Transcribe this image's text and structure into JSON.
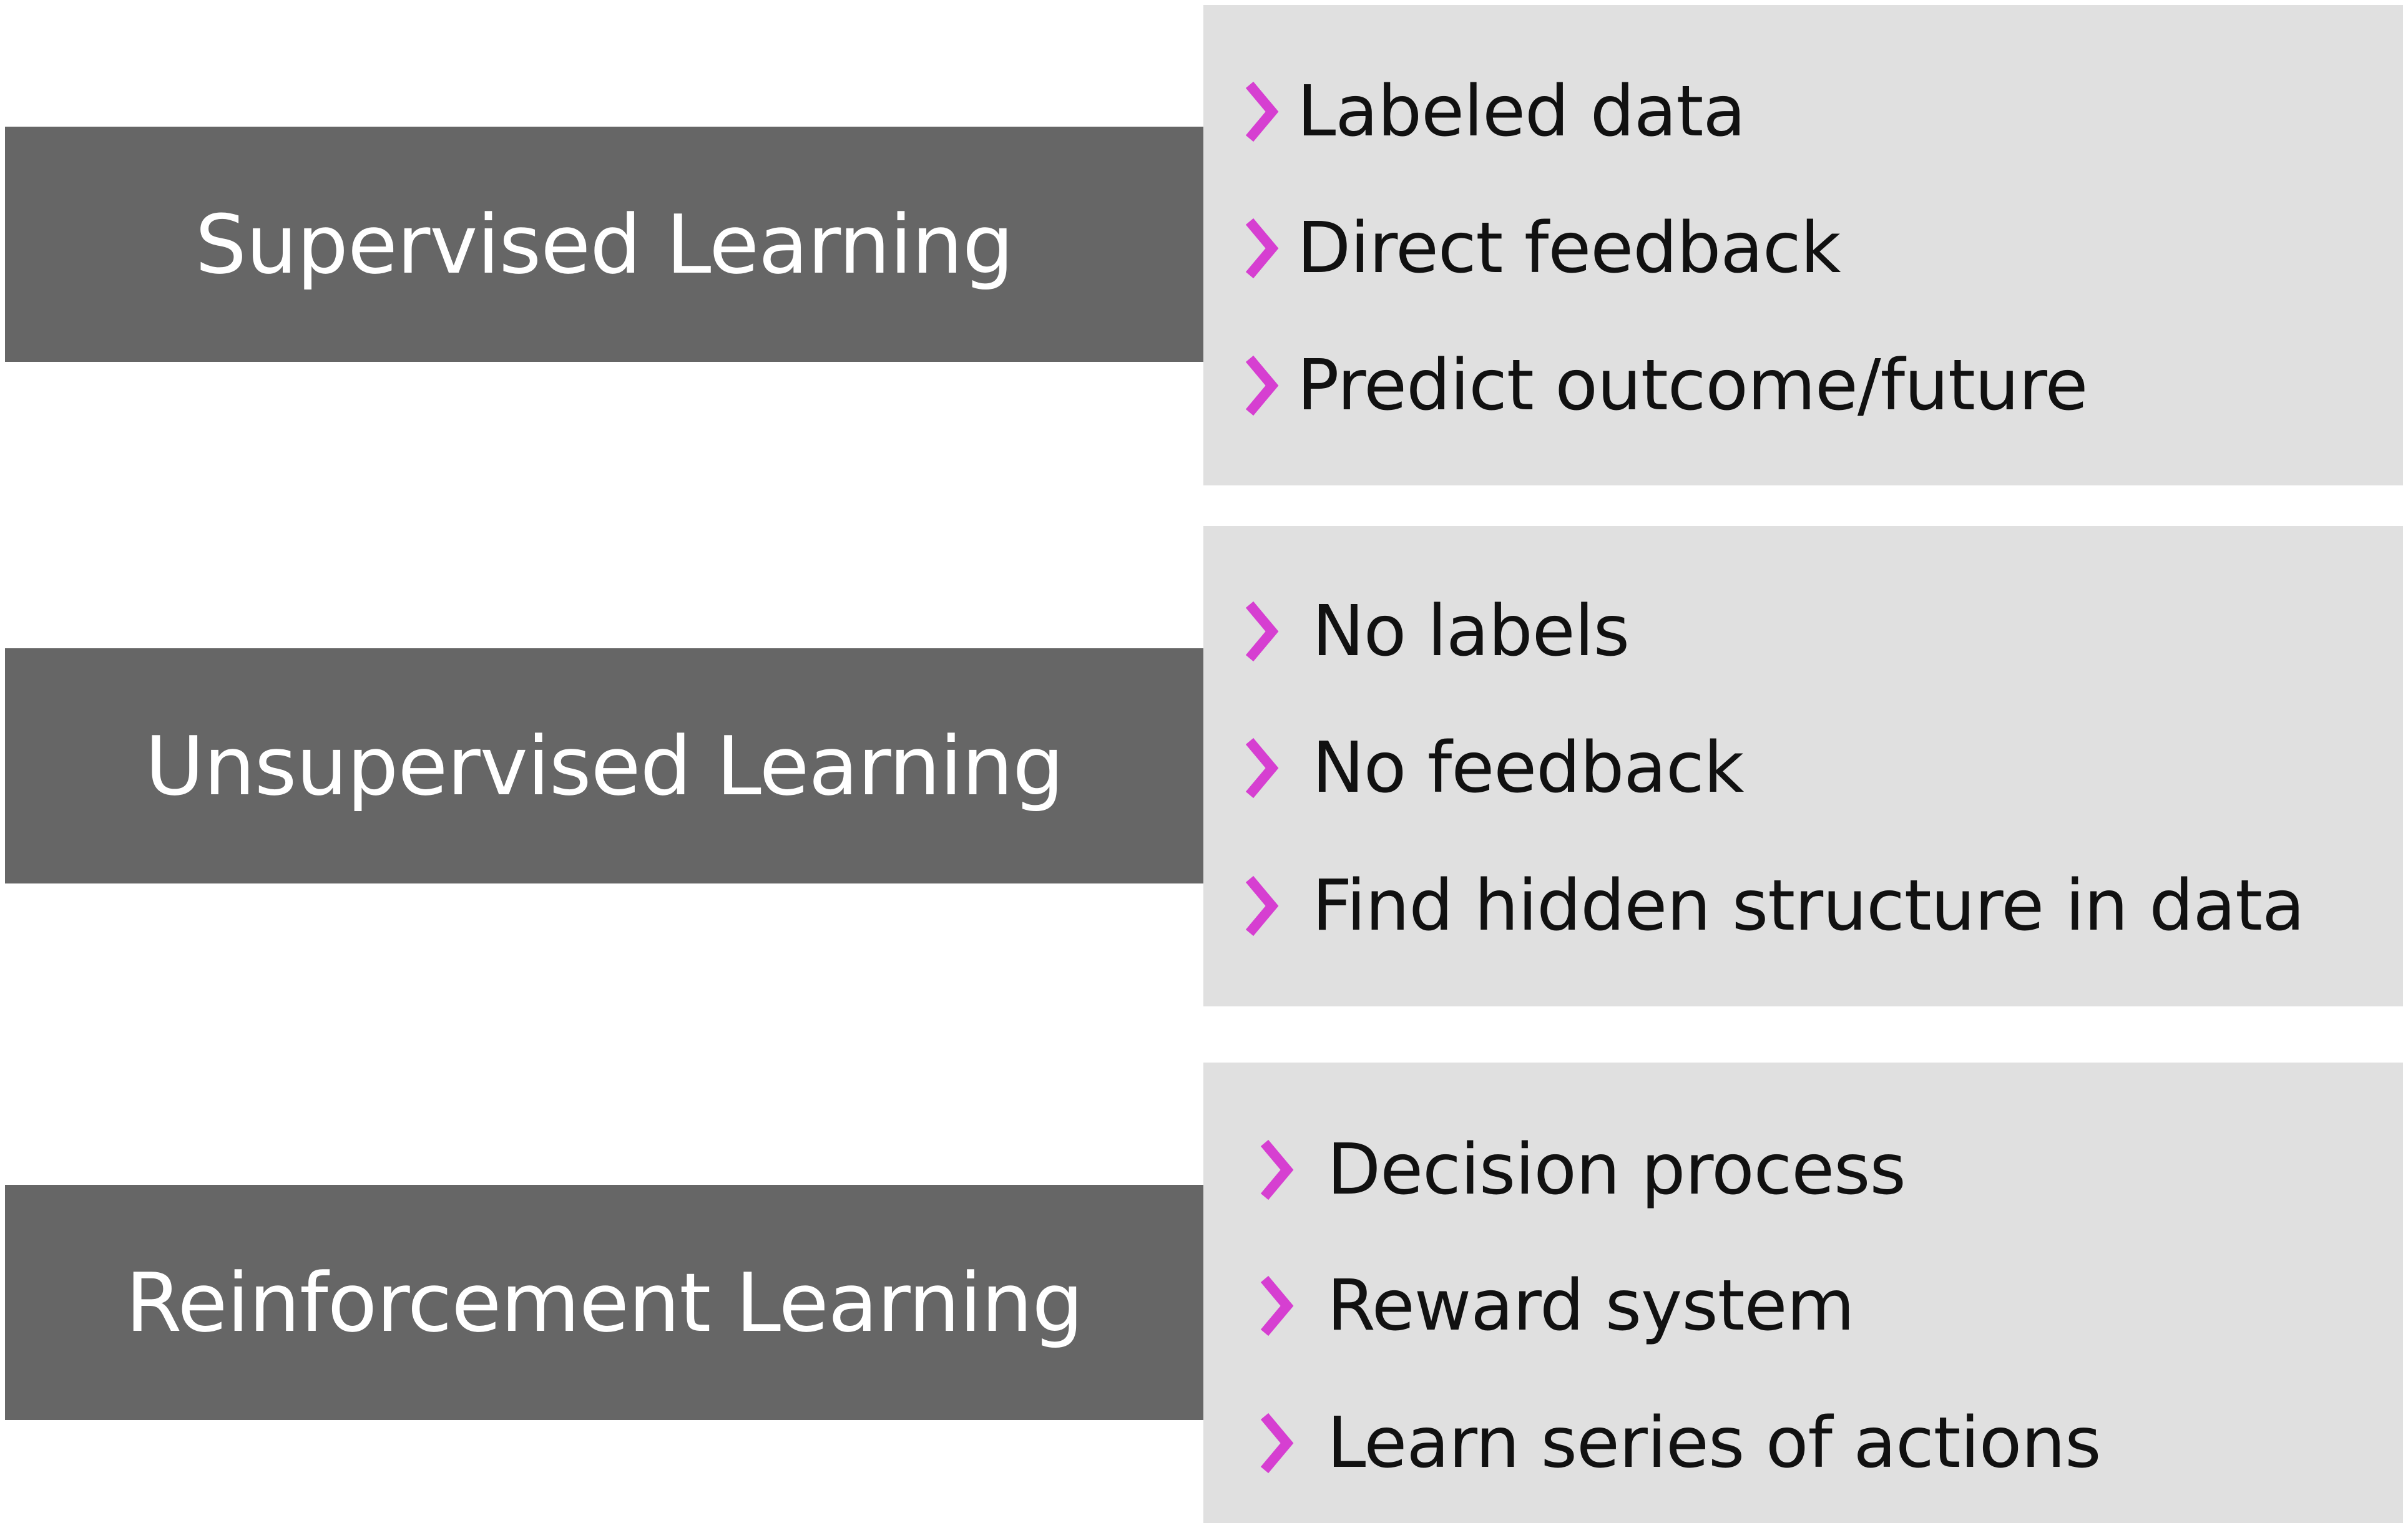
{
  "colors": {
    "title_bg": "#666666",
    "title_text": "#ffffff",
    "detail_bg": "#e0e0e0",
    "chevron": "#d63fd1",
    "detail_text": "#111111"
  },
  "bullet_icon": "chevron-right-icon",
  "categories": [
    {
      "title": "Supervised Learning",
      "points": [
        "Labeled data",
        "Direct feedback",
        "Predict outcome/future"
      ]
    },
    {
      "title": "Unsupervised Learning",
      "points": [
        "No labels",
        "No feedback",
        "Find hidden structure in data"
      ]
    },
    {
      "title": "Reinforcement Learning",
      "points": [
        "Decision process",
        "Reward system",
        "Learn series of actions"
      ]
    }
  ]
}
